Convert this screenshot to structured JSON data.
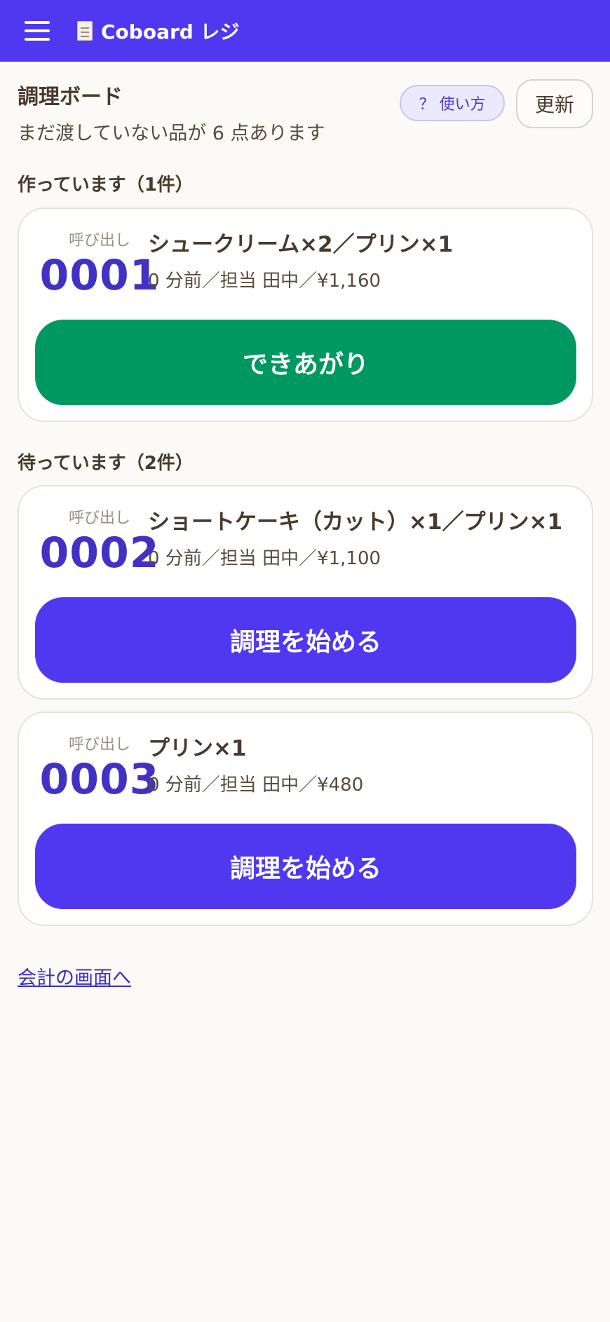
{
  "header": {
    "app_title": "Coboard レジ",
    "colors": {
      "bar": "#4f38f0"
    },
    "icons": [
      "menu-icon",
      "receipt-icon"
    ]
  },
  "board": {
    "title": "調理ボード",
    "subtitle": "まだ渡していない品が 6 点あります",
    "help_label": "？ 使い方",
    "refresh_label": "更新"
  },
  "sections": {
    "in_progress": "作っています（1件）",
    "waiting": "待っています（2件）"
  },
  "orders": [
    {
      "call_label": "呼び出し",
      "number": "0001",
      "items": "シュークリーム×2／プリン×1",
      "meta": "0 分前／担当 田中／¥1,160",
      "action": "できあがり"
    },
    {
      "call_label": "呼び出し",
      "number": "0002",
      "items": "ショートケーキ（カット）×1／プリン×1",
      "meta": "0 分前／担当 田中／¥1,100",
      "action": "調理を始める"
    },
    {
      "call_label": "呼び出し",
      "number": "0003",
      "items": "プリン×1",
      "meta": "0 分前／担当 田中／¥480",
      "action": "調理を始める"
    }
  ],
  "footer": {
    "link": "会計の画面へ"
  }
}
